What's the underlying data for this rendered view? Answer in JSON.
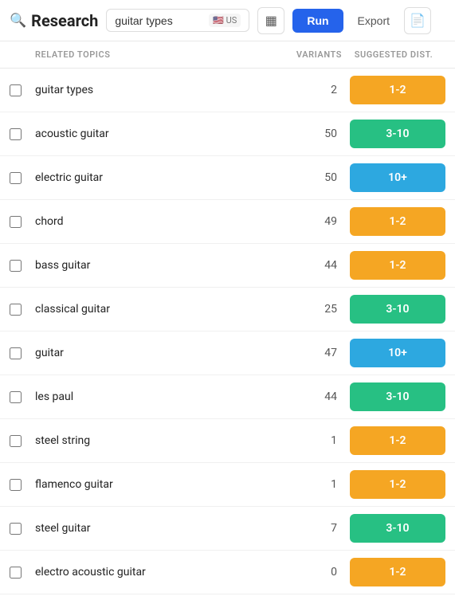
{
  "header": {
    "title": "Research",
    "search_value": "guitar types",
    "flag_emoji": "🇺🇸",
    "flag_code": "US",
    "run_label": "Run",
    "export_label": "Export"
  },
  "table": {
    "col_topic": "RELATED TOPICS",
    "col_variants": "VARIANTS",
    "col_dist": "SUGGESTED DIST.",
    "rows": [
      {
        "topic": "guitar types",
        "variants": "2",
        "dist": "1-2",
        "color": "yellow"
      },
      {
        "topic": "acoustic guitar",
        "variants": "50",
        "dist": "3-10",
        "color": "green"
      },
      {
        "topic": "electric guitar",
        "variants": "50",
        "dist": "10+",
        "color": "blue"
      },
      {
        "topic": "chord",
        "variants": "49",
        "dist": "1-2",
        "color": "yellow"
      },
      {
        "topic": "bass guitar",
        "variants": "44",
        "dist": "1-2",
        "color": "yellow"
      },
      {
        "topic": "classical guitar",
        "variants": "25",
        "dist": "3-10",
        "color": "green"
      },
      {
        "topic": "guitar",
        "variants": "47",
        "dist": "10+",
        "color": "blue"
      },
      {
        "topic": "les paul",
        "variants": "44",
        "dist": "3-10",
        "color": "green"
      },
      {
        "topic": "steel string",
        "variants": "1",
        "dist": "1-2",
        "color": "yellow"
      },
      {
        "topic": "flamenco guitar",
        "variants": "1",
        "dist": "1-2",
        "color": "yellow"
      },
      {
        "topic": "steel guitar",
        "variants": "7",
        "dist": "3-10",
        "color": "green"
      },
      {
        "topic": "electro acoustic guitar",
        "variants": "0",
        "dist": "1-2",
        "color": "yellow"
      }
    ]
  }
}
